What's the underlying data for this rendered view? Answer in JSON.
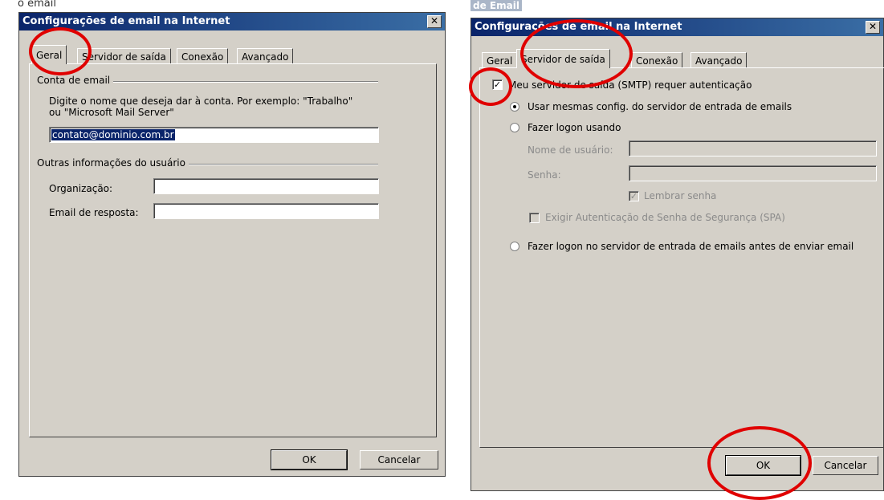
{
  "left_caption": "o email",
  "left_dialog": {
    "title": "Configurações de email na Internet",
    "close_glyph": "✕",
    "tabs": [
      "Geral",
      "Servidor de saída",
      "Conexão",
      "Avançado"
    ],
    "active_tab": "Geral",
    "group_email_account": "Conta de email",
    "account_help_line1": "Digite o nome que deseja dar à conta. Por exemplo: \"Trabalho\"",
    "account_help_line2": "ou \"Microsoft Mail Server\"",
    "account_name_value": "contato@dominio.com.br",
    "group_user_info": "Outras informações do usuário",
    "organization_label": "Organização:",
    "organization_value": "",
    "reply_email_label": "Email de resposta:",
    "reply_email_value": "",
    "ok_label": "OK",
    "cancel_label": "Cancelar"
  },
  "right_dialog": {
    "above_title": "de Email",
    "title": "Configurações de email na Internet",
    "close_glyph": "✕",
    "tabs": [
      "Geral",
      "Servidor de saída",
      "Conexão",
      "Avançado"
    ],
    "active_tab": "Servidor de saída",
    "smtp_auth_checkbox_label": "Meu servidor de saída (SMTP) requer autenticação",
    "smtp_auth_checked": true,
    "radio_same_settings": "Usar mesmas config. do servidor de entrada de emails",
    "radio_logon_using": "Fazer logon usando",
    "username_label": "Nome de usuário:",
    "username_value": "",
    "password_label": "Senha:",
    "password_value": "",
    "remember_password_label": "Lembrar senha",
    "spa_label": "Exigir Autenticação de Senha de Segurança (SPA)",
    "radio_logon_incoming": "Fazer logon no servidor de entrada de emails antes de enviar email",
    "ok_label": "OK",
    "cancel_label": "Cancelar",
    "check_glyph": "✓"
  },
  "colors": {
    "annotation_ring": "#e00000",
    "titlebar_start": "#0a246a",
    "titlebar_end": "#3a6ea5",
    "dialog_face": "#d4d0c8"
  }
}
